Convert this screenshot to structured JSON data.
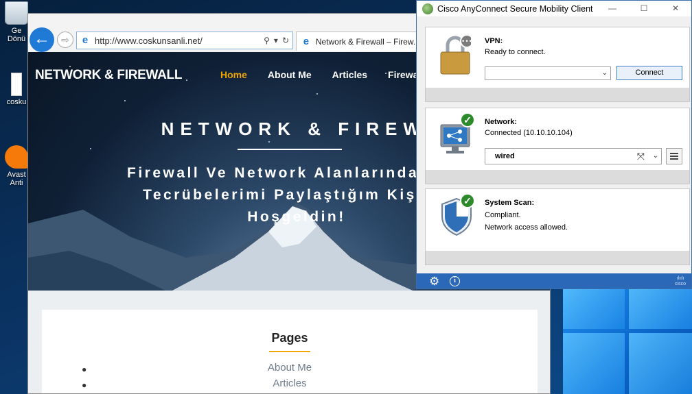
{
  "desktop": {
    "icons": [
      {
        "label": "Ge\nDönü",
        "icon": "recycle-bin-icon"
      },
      {
        "label": "cosku",
        "icon": "document-icon"
      },
      {
        "label": "Avast\nAnti",
        "icon": "avast-icon"
      }
    ]
  },
  "browser": {
    "url": "http://www.coskunsanli.net/",
    "tab_title": "Network & Firewall – Firew...",
    "site": {
      "title": "NETWORK & FIREWALL",
      "nav": [
        "Home",
        "About Me",
        "Articles",
        "Firewa"
      ],
      "hero_heading": "NETWORK & FIREWA",
      "hero_sub_line1": "Firewall Ve Network Alanlarında Edin",
      "hero_sub_line2": "Tecrübelerimi Paylaştığım Kişisel",
      "hero_sub_line3": "Hoşgeldin!",
      "pages_title": "Pages",
      "pages": [
        "About Me",
        "Articles"
      ]
    }
  },
  "cisco": {
    "title": "Cisco AnyConnect Secure Mobility Client",
    "vpn": {
      "label": "VPN:",
      "status": "Ready to connect.",
      "select_value": "",
      "connect_label": "Connect"
    },
    "network": {
      "label": "Network:",
      "status": "Connected (10.10.10.104)",
      "select_value": "wired"
    },
    "scan": {
      "label": "System Scan:",
      "status1": "Compliant.",
      "status2": "Network access allowed."
    },
    "brand": "cisco"
  },
  "colors": {
    "accent_orange": "#f0a500",
    "cisco_blue": "#2b68b8",
    "check_green": "#2d8a2a"
  }
}
